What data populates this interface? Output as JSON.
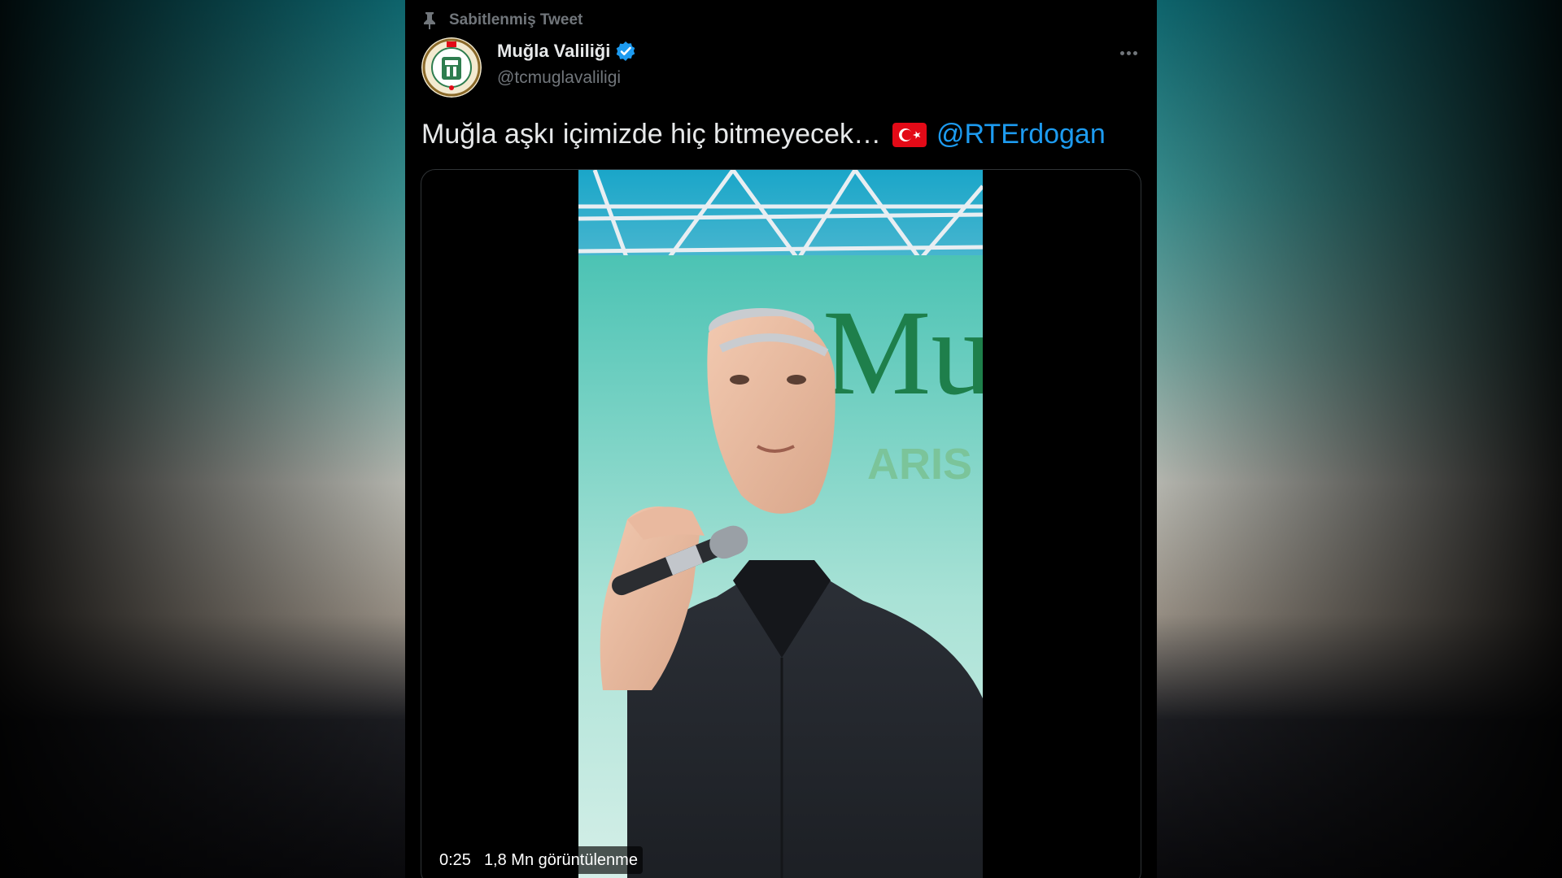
{
  "pinned_label": "Sabitlenmiş Tweet",
  "author": {
    "display_name": "Muğla Valiliği",
    "handle": "@tcmuglavaliligi",
    "avatar_text": "MUĞLA VALİLİĞİ"
  },
  "tweet": {
    "text": "Muğla aşkı içimizde hiç bitmeyecek…",
    "mention": "@RTErdogan"
  },
  "video": {
    "duration": "0:25",
    "views": "1,8 Mn görüntülenme",
    "banner_text": "Mu",
    "banner_subtext": "ARIS"
  },
  "icons": {
    "pin": "pin-icon",
    "verified": "verified-badge-icon",
    "more": "more-options-icon",
    "flag": "turkey-flag-icon"
  },
  "colors": {
    "accent": "#1d9bf0",
    "muted": "#71767b",
    "text": "#e7e9ea",
    "background": "#000000",
    "flag_red": "#e30a17"
  }
}
